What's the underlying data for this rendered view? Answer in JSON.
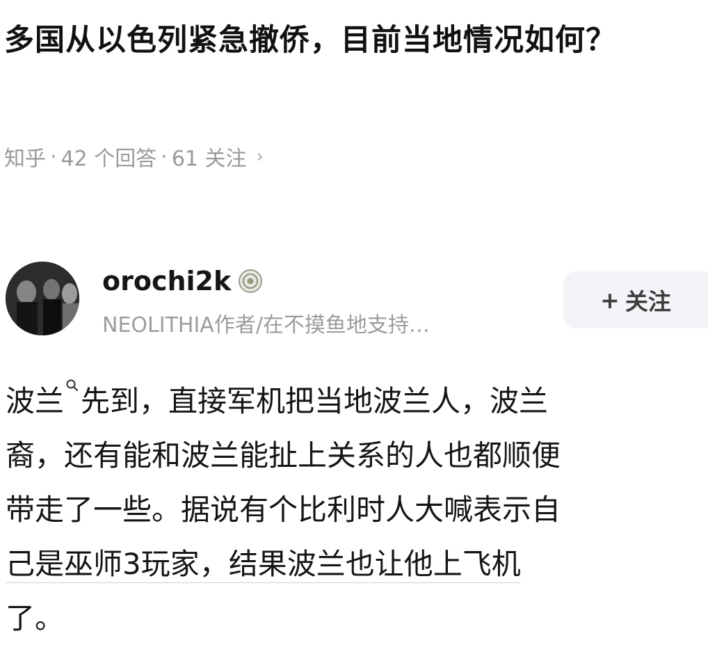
{
  "question": {
    "title": "多国从以色列紧急撤侨，目前当地情况如何？",
    "source": "知乎",
    "answers": "42 个回答",
    "followers": "61 关注"
  },
  "author": {
    "name": "orochi2k",
    "bio": "NEOLITHIA作者/在不摸鱼地支持…",
    "follow_label": "关注",
    "follow_plus": "+",
    "badge_icon": "verified-badge-icon"
  },
  "answer": {
    "line1_a": "波兰",
    "line1_b": "先到，直接军机把当地波兰人，波兰",
    "line2": "裔，还有能和波兰能扯上关系的人也都顺便",
    "line3": "带走了一些。据说有个比利时人大喊表示自",
    "line4": "己是巫师3玩家，结果波兰也让他上飞机",
    "line5": "了。"
  },
  "colors": {
    "text_primary": "#111111",
    "text_secondary": "#9a9a9a",
    "button_bg": "#f2f4f7"
  }
}
